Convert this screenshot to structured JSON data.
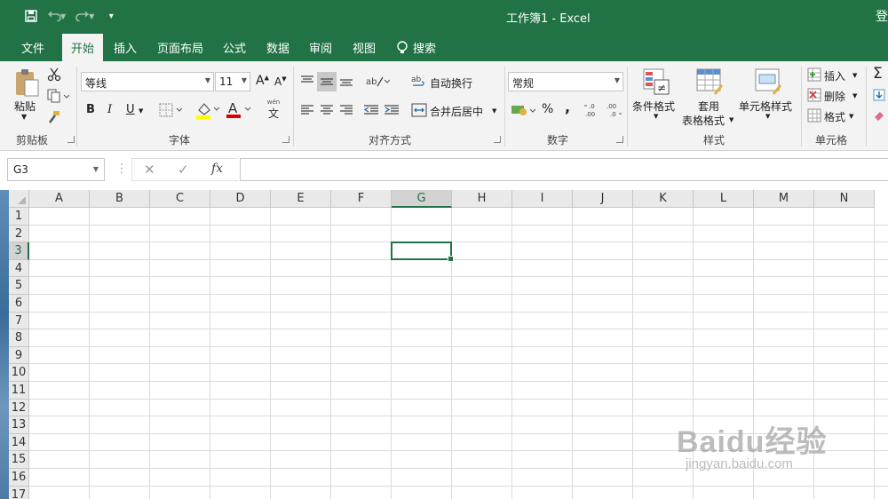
{
  "window": {
    "title": "工作簿1  -  Excel",
    "user_partial": "登"
  },
  "qat": {
    "save_icon": "save-icon",
    "undo_icon": "undo-icon",
    "redo_icon": "redo-icon",
    "more": "▾"
  },
  "tabs": [
    {
      "label": "文件",
      "active": false
    },
    {
      "label": "开始",
      "active": true
    },
    {
      "label": "插入",
      "active": false
    },
    {
      "label": "页面布局",
      "active": false
    },
    {
      "label": "公式",
      "active": false
    },
    {
      "label": "数据",
      "active": false
    },
    {
      "label": "审阅",
      "active": false
    },
    {
      "label": "视图",
      "active": false
    }
  ],
  "tell_me": "搜索",
  "ribbon": {
    "clipboard": {
      "paste": "粘贴",
      "label": "剪贴板"
    },
    "font": {
      "name": "等线",
      "size": "11",
      "bold": "B",
      "italic": "I",
      "underline": "U",
      "label": "字体",
      "grow": "A",
      "shrink": "A",
      "wen": "文"
    },
    "alignment": {
      "wrap": "自动换行",
      "merge": "合并后居中",
      "label": "对齐方式"
    },
    "number": {
      "format": "常规",
      "percent": "%",
      "comma": ",",
      "inc": "←.0 .00",
      "dec": ".00 →.0",
      "label": "数字"
    },
    "styles": {
      "conditional": "条件格式",
      "table_line1": "套用",
      "table_line2": "表格格式",
      "cell_styles": "单元格样式",
      "label": "样式"
    },
    "cells": {
      "insert": "插入",
      "delete": "删除",
      "format": "格式",
      "label": "单元格"
    },
    "editing": {
      "sum": "Σ"
    }
  },
  "formula_bar": {
    "name_box": "G3",
    "cancel": "✕",
    "enter": "✓",
    "fx": "fx",
    "value": ""
  },
  "columns": [
    "A",
    "B",
    "C",
    "D",
    "E",
    "F",
    "G",
    "H",
    "I",
    "J",
    "K",
    "L",
    "M",
    "N"
  ],
  "rows": [
    "1",
    "2",
    "3",
    "4",
    "5",
    "6",
    "7",
    "8",
    "9",
    "10",
    "11",
    "12",
    "13",
    "14",
    "15",
    "16",
    "17"
  ],
  "active_cell": {
    "col": "G",
    "row": "3"
  },
  "watermark": {
    "main": "Baidu经验",
    "sub": "jingyan.baidu.com"
  },
  "colors": {
    "accent": "#217346",
    "ribbon_bg": "#f3f3f3",
    "gridline": "#dadada"
  }
}
